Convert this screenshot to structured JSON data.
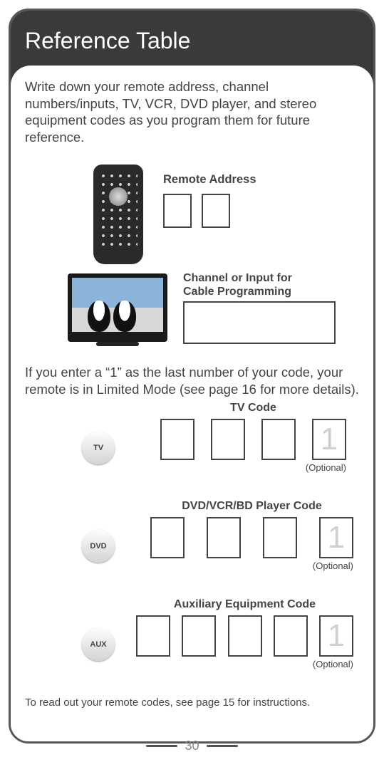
{
  "header": {
    "title": "Reference Table"
  },
  "intro": "Write down your remote address, channel numbers/inputs, TV, VCR, DVD player, and stereo equipment codes as you program them for future reference.",
  "remote_address": {
    "label": "Remote Address"
  },
  "channel_input": {
    "label_line1": "Channel or Input for",
    "label_line2": "Cable Programming"
  },
  "limited_note": "If you enter a “1” as the last number of your code, your remote is in Limited Mode (see page 16 for more details).",
  "codes": {
    "tv": {
      "btn": "TV",
      "title": "TV Code",
      "optional_digit": "1",
      "optional_label": "(Optional)"
    },
    "dvd": {
      "btn": "DVD",
      "title": "DVD/VCR/BD Player Code",
      "optional_digit": "1",
      "optional_label": "(Optional)"
    },
    "aux": {
      "btn": "AUX",
      "title": "Auxiliary Equipment Code",
      "optional_digit": "1",
      "optional_label": "(Optional)"
    }
  },
  "footer": "To read out your remote codes, see page 15 for instructions.",
  "page_number": "30"
}
